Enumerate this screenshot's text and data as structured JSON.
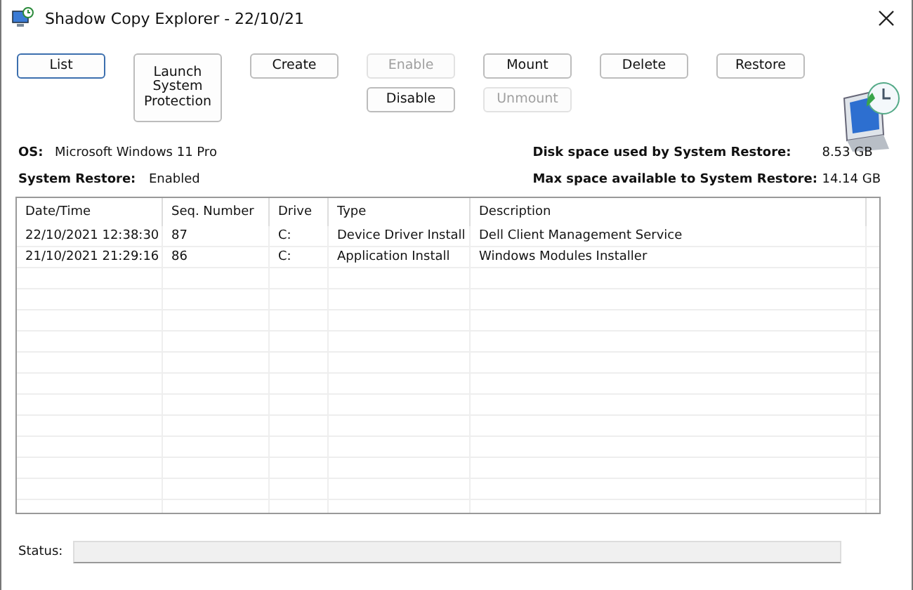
{
  "window": {
    "title": "Shadow Copy Explorer - 22/10/21"
  },
  "button_columns": [
    [
      {
        "label": "List",
        "disabled": false,
        "focused": true
      }
    ],
    [
      {
        "label": "Launch System Protection",
        "disabled": false,
        "focused": false
      }
    ],
    [
      {
        "label": "Create",
        "disabled": false,
        "focused": false
      }
    ],
    [
      {
        "label": "Enable",
        "disabled": true,
        "focused": false
      },
      {
        "label": "Disable",
        "disabled": false,
        "focused": false
      }
    ],
    [
      {
        "label": "Mount",
        "disabled": false,
        "focused": false
      },
      {
        "label": "Unmount",
        "disabled": true,
        "focused": false
      }
    ],
    [
      {
        "label": "Delete",
        "disabled": false,
        "focused": false
      }
    ],
    [
      {
        "label": "Restore",
        "disabled": false,
        "focused": false
      }
    ]
  ],
  "info_left": [
    {
      "label": "OS:",
      "value": "Microsoft Windows 11 Pro"
    },
    {
      "label": "System Restore:",
      "value": "Enabled"
    }
  ],
  "info_right": [
    {
      "label": "Disk space used by System Restore:",
      "value": "8.53 GB"
    },
    {
      "label": "Max space available to System Restore:",
      "value": "14.14 GB"
    }
  ],
  "table": {
    "columns": [
      "Date/Time",
      "Seq. Number",
      "Drive",
      "Type",
      "Description"
    ],
    "rows": [
      [
        "22/10/2021 12:38:30",
        "87",
        "C:",
        "Device Driver Install",
        "Dell Client Management Service"
      ],
      [
        "21/10/2021 21:29:16",
        "86",
        "C:",
        "Application Install",
        "Windows Modules Installer"
      ]
    ]
  },
  "status_bar": {
    "label": "Status:"
  }
}
